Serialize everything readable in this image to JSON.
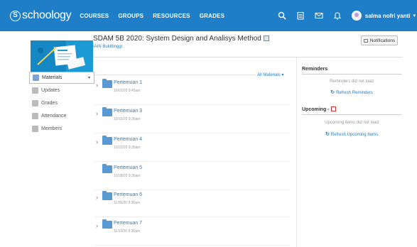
{
  "brand": {
    "logo_text": "schoology",
    "logo_mark": "S"
  },
  "nav": [
    "COURSES",
    "GROUPS",
    "RESOURCES",
    "GRADES"
  ],
  "top_icons": [
    "search-icon",
    "calendar-icon",
    "mail-icon",
    "bell-icon"
  ],
  "user": {
    "name": "salma nofri yanti"
  },
  "course": {
    "title": "SDAM 5B 2020: System Design and Analisys Method",
    "subtitle": "IAIN Bukittinggi"
  },
  "notifications_button": "Notifications",
  "left_nav": [
    {
      "label": "Materials",
      "icon": "materials-icon"
    },
    {
      "label": "Updates",
      "icon": "updates-icon"
    },
    {
      "label": "Grades",
      "icon": "grades-icon"
    },
    {
      "label": "Attendance",
      "icon": "attendance-icon"
    },
    {
      "label": "Members",
      "icon": "members-icon"
    }
  ],
  "materials": {
    "filter_label": "All Materials",
    "folders": [
      {
        "title": "Pertemuan 1",
        "date": "10/01/20 9:45am"
      },
      {
        "title": "Pertemuan 3",
        "date": "10/15/20 9:30am"
      },
      {
        "title": "Pertemuan 4",
        "date": "10/22/20 9:30am"
      },
      {
        "title": "Pertemuan 5",
        "date": "10/28/20 9:30am"
      },
      {
        "title": "Pertemuan 6",
        "date": "11/05/20 9:30am"
      },
      {
        "title": "Pertemuan 7",
        "date": "11/12/20 9:30am"
      }
    ]
  },
  "reminders": {
    "heading": "Reminders",
    "message": "Reminders did not load",
    "refresh_label": "Refresh Reminders"
  },
  "upcoming": {
    "heading": "Upcoming -",
    "message": "Upcoming items did not load",
    "refresh_label": "Refresh Upcoming Items"
  },
  "colors": {
    "brand_blue": "#1e7ec8",
    "folder_blue": "#5a9ad3"
  }
}
